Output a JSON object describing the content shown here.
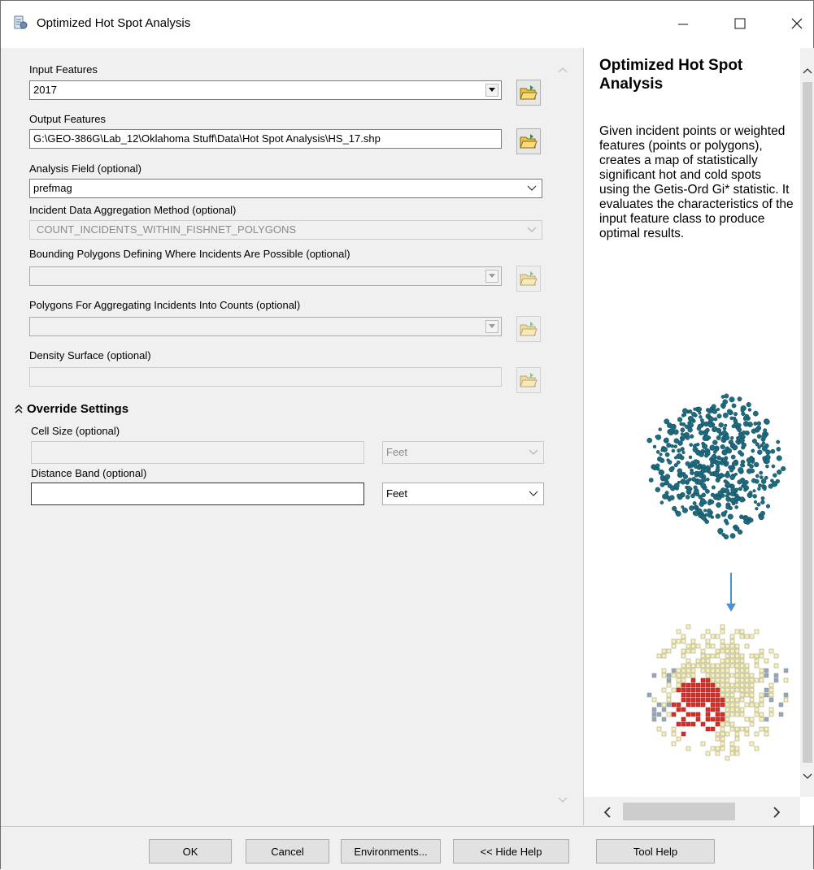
{
  "window": {
    "title": "Optimized Hot Spot Analysis"
  },
  "form": {
    "input_features": {
      "label": "Input Features",
      "value": "2017"
    },
    "output_features": {
      "label": "Output Features",
      "value": "G:\\GEO-386G\\Lab_12\\Oklahoma Stuff\\Data\\Hot Spot Analysis\\HS_17.shp"
    },
    "analysis_field": {
      "label": "Analysis Field (optional)",
      "value": "prefmag"
    },
    "aggregation_method": {
      "label": "Incident Data Aggregation Method (optional)",
      "value": "COUNT_INCIDENTS_WITHIN_FISHNET_POLYGONS"
    },
    "bounding_polygons": {
      "label": "Bounding Polygons Defining Where Incidents Are Possible (optional)",
      "value": ""
    },
    "aggregating_polygons": {
      "label": "Polygons For Aggregating Incidents Into Counts (optional)",
      "value": ""
    },
    "density_surface": {
      "label": "Density Surface (optional)",
      "value": ""
    },
    "override": {
      "section_label": "Override Settings",
      "cell_size": {
        "label": "Cell Size (optional)",
        "value": "",
        "unit": "Feet"
      },
      "distance_band": {
        "label": "Distance Band (optional)",
        "value": "",
        "unit": "Feet"
      }
    }
  },
  "help": {
    "title": "Optimized Hot Spot Analysis",
    "description": "Given incident points or weighted features (points or polygons), creates a map of statistically significant hot and cold spots using the Getis-Ord Gi* statistic. It evaluates the characteristics of the input feature class to produce optimal results.",
    "colors": {
      "points": "#1f6b80",
      "hot": "#d62f27",
      "neutral": "#f5f0bd",
      "cold": "#8ea6cc",
      "arrow": "#4a90d9"
    }
  },
  "buttons": {
    "ok": "OK",
    "cancel": "Cancel",
    "environments": "Environments...",
    "hide_help": "<< Hide Help",
    "tool_help": "Tool Help"
  },
  "icons": {
    "app": "toolbox-script-icon",
    "browse": "open-folder-icon",
    "collapse": "double-chevron-up-icon"
  }
}
